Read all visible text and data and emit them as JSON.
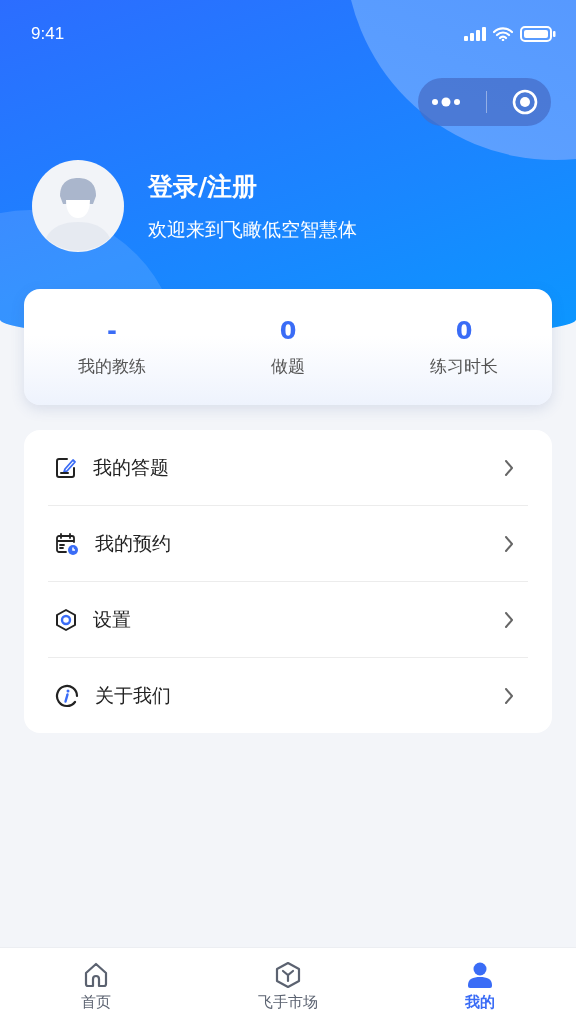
{
  "status_bar": {
    "time": "9:41"
  },
  "profile": {
    "title": "登录/注册",
    "subtitle": "欢迎来到飞瞰低空智慧体"
  },
  "stats": [
    {
      "value": "-",
      "label": "我的教练"
    },
    {
      "value": "0",
      "label": "做题"
    },
    {
      "value": "0",
      "label": "练习时长"
    }
  ],
  "menu": [
    {
      "kind": "answers",
      "label": "我的答题"
    },
    {
      "kind": "booking",
      "label": "我的预约"
    },
    {
      "kind": "settings",
      "label": "设置"
    },
    {
      "kind": "about",
      "label": "关于我们"
    }
  ],
  "tabs": [
    {
      "kind": "home",
      "label": "首页",
      "selected": false
    },
    {
      "kind": "market",
      "label": "飞手市场",
      "selected": false
    },
    {
      "kind": "me",
      "label": "我的",
      "selected": true
    }
  ]
}
